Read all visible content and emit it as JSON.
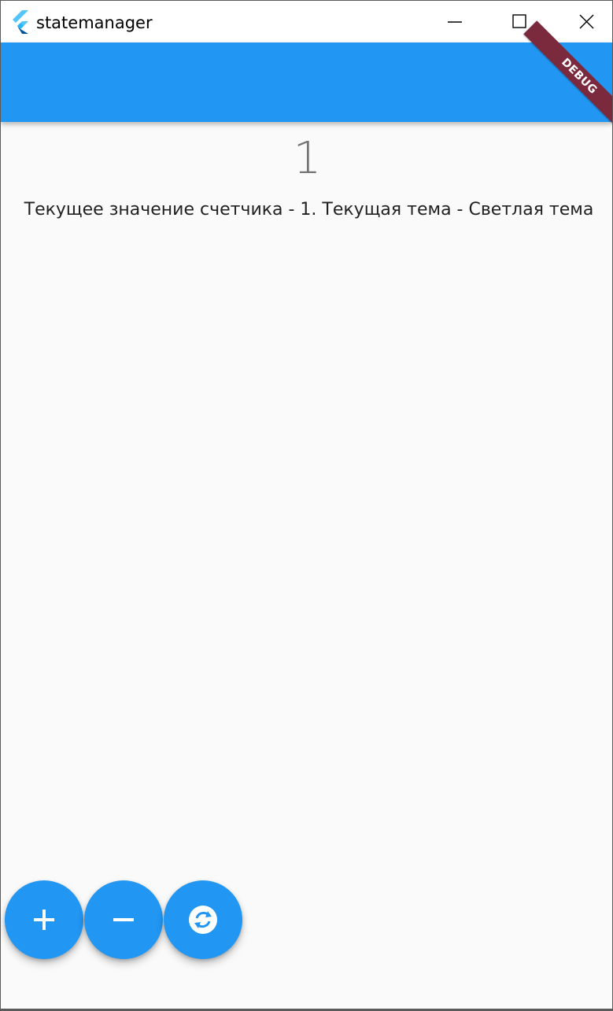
{
  "window": {
    "title": "statemanager",
    "icon": "flutter-logo-icon",
    "controls": [
      "minimize-icon",
      "maximize-icon",
      "close-icon"
    ]
  },
  "appbar": {
    "color": "#2196f3",
    "debug_banner": "DEBUG"
  },
  "main": {
    "counter_value": "1",
    "status_text": "Текущее значение счетчика - 1. Текущая тема - Светлая тема"
  },
  "fabs": [
    {
      "name": "increment",
      "icon": "plus-icon"
    },
    {
      "name": "decrement",
      "icon": "minus-icon"
    },
    {
      "name": "toggle-theme",
      "icon": "sync-icon"
    }
  ],
  "colors": {
    "primary": "#2196f3",
    "background": "#fafafa",
    "banner": "#7b2a3e"
  }
}
